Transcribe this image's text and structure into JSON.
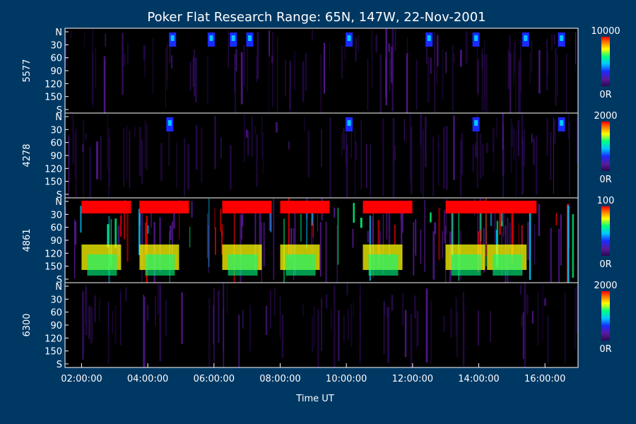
{
  "title": "Poker Flat Research Range: 65N, 147W, 22-Nov-2001",
  "xlabel": "Time UT",
  "x_ticks": [
    "02:00:00",
    "04:00:00",
    "06:00:00",
    "08:00:00",
    "10:00:00",
    "12:00:00",
    "14:00:00",
    "16:00:00"
  ],
  "x_range": [
    "01:30:00",
    "17:00:00"
  ],
  "colors": {
    "background": "#003864",
    "plot_background": "#000000",
    "axis": "#ffffff",
    "colormap": [
      "#2a0a52",
      "#5a1a9a",
      "#1a2aff",
      "#00c8ff",
      "#00ff80",
      "#ffff00",
      "#ff8000",
      "#ff0000"
    ]
  },
  "chart_data": [
    {
      "type": "heatmap",
      "ylabel": "5577",
      "y_ticks": [
        "N",
        "30",
        "60",
        "90",
        "120",
        "150",
        "S"
      ],
      "colorbar": {
        "max_label": "10000",
        "min_label": "0R"
      },
      "panel_activity": "low",
      "bright_times": [
        "04:45:00",
        "05:55:00",
        "06:35:00",
        "07:05:00",
        "10:05:00",
        "12:30:00",
        "13:55:00",
        "15:25:00",
        "16:30:00"
      ]
    },
    {
      "type": "heatmap",
      "ylabel": "4278",
      "y_ticks": [
        "N",
        "30",
        "60",
        "90",
        "120",
        "150",
        "S"
      ],
      "colorbar": {
        "max_label": "2000",
        "min_label": "0R"
      },
      "panel_activity": "low",
      "bright_times": [
        "04:40:00",
        "10:05:00",
        "13:55:00",
        "16:30:00"
      ]
    },
    {
      "type": "heatmap",
      "ylabel": "4861",
      "y_ticks": [
        "N",
        "30",
        "60",
        "90",
        "120",
        "150",
        "S"
      ],
      "colorbar": {
        "max_label": "100",
        "min_label": "0R"
      },
      "panel_activity": "high",
      "bright_times": [
        "02:00:00",
        "03:45:00",
        "06:15:00",
        "08:00:00",
        "10:30:00",
        "13:00:00",
        "14:15:00"
      ]
    },
    {
      "type": "heatmap",
      "ylabel": "6300",
      "y_ticks": [
        "N",
        "30",
        "60",
        "90",
        "120",
        "150",
        "S"
      ],
      "colorbar": {
        "max_label": "2000",
        "min_label": "0R"
      },
      "panel_activity": "very-low",
      "bright_times": []
    }
  ]
}
